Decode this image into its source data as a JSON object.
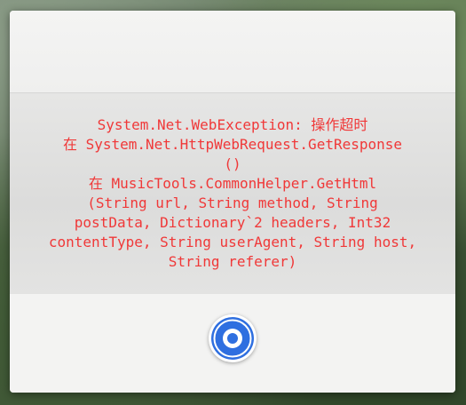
{
  "dialog": {
    "message": "System.Net.WebException: 操作超时\n在 System.Net.HttpWebRequest.GetResponse\n()\n在 MusicTools.CommonHelper.GetHtml\n(String url, String method, String\npostData, Dictionary`2 headers, Int32\ncontentType, String userAgent, String host,\nString referer)",
    "message_color": "#f03838",
    "confirm_icon": "circle-button-icon",
    "accent_color": "#2f6fe0"
  }
}
